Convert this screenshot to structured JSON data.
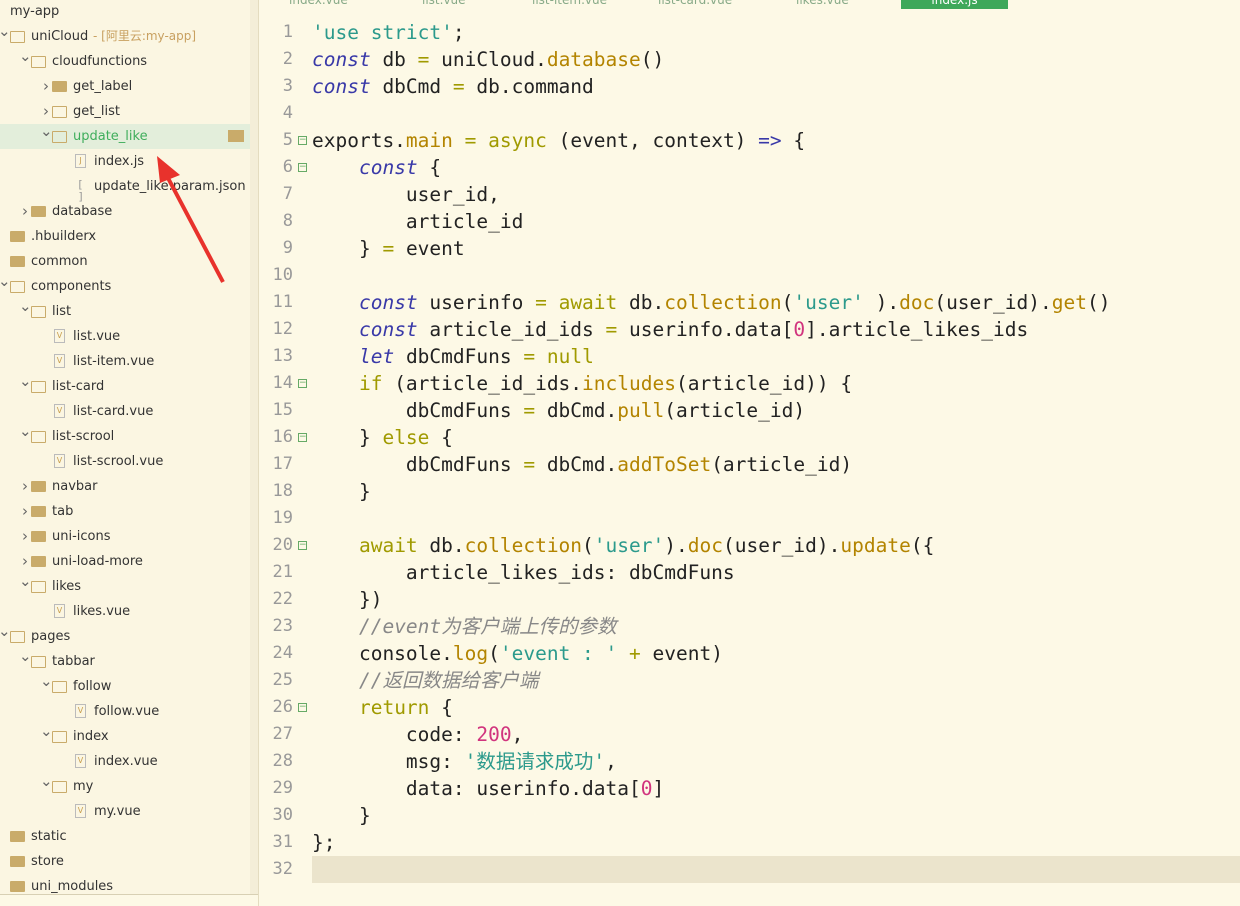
{
  "tabs": [
    {
      "label": "index.vue"
    },
    {
      "label": "list.vue"
    },
    {
      "label": "list-item.vue"
    },
    {
      "label": "list-card.vue"
    },
    {
      "label": "likes.vue"
    },
    {
      "label": "index.js",
      "active": true
    }
  ],
  "tree": [
    {
      "label": "my-app",
      "level": -1,
      "type": "root"
    },
    {
      "label": "uniCloud",
      "extra": " - [阿里云:my-app]",
      "level": 0,
      "type": "folder",
      "open": true
    },
    {
      "label": "cloudfunctions",
      "level": 1,
      "type": "folder",
      "open": true
    },
    {
      "label": "get_label",
      "level": 2,
      "type": "folder",
      "open": false
    },
    {
      "label": "get_list",
      "level": 2,
      "type": "folder",
      "open": false,
      "openIcon": true
    },
    {
      "label": "update_like",
      "level": 2,
      "type": "folder",
      "open": true,
      "selected": true
    },
    {
      "label": "index.js",
      "level": 3,
      "type": "file",
      "icon": "js"
    },
    {
      "label": "update_like.param.json",
      "level": 3,
      "type": "file",
      "icon": "json"
    },
    {
      "label": "database",
      "level": 1,
      "type": "folder",
      "open": false
    },
    {
      "label": ".hbuilderx",
      "level": 0,
      "type": "folder",
      "noarrow": true
    },
    {
      "label": "common",
      "level": 0,
      "type": "folder",
      "noarrow": true
    },
    {
      "label": "components",
      "level": 0,
      "type": "folder",
      "open": true
    },
    {
      "label": "list",
      "level": 1,
      "type": "folder",
      "open": true
    },
    {
      "label": "list.vue",
      "level": 2,
      "type": "file",
      "icon": "vue"
    },
    {
      "label": "list-item.vue",
      "level": 2,
      "type": "file",
      "icon": "vue"
    },
    {
      "label": "list-card",
      "level": 1,
      "type": "folder",
      "open": true
    },
    {
      "label": "list-card.vue",
      "level": 2,
      "type": "file",
      "icon": "vue"
    },
    {
      "label": "list-scrool",
      "level": 1,
      "type": "folder",
      "open": true
    },
    {
      "label": "list-scrool.vue",
      "level": 2,
      "type": "file",
      "icon": "vue"
    },
    {
      "label": "navbar",
      "level": 1,
      "type": "folder",
      "open": false
    },
    {
      "label": "tab",
      "level": 1,
      "type": "folder",
      "open": false
    },
    {
      "label": "uni-icons",
      "level": 1,
      "type": "folder",
      "open": false
    },
    {
      "label": "uni-load-more",
      "level": 1,
      "type": "folder",
      "open": false
    },
    {
      "label": "likes",
      "level": 1,
      "type": "folder",
      "open": true
    },
    {
      "label": "likes.vue",
      "level": 2,
      "type": "file",
      "icon": "vue"
    },
    {
      "label": "pages",
      "level": 0,
      "type": "folder",
      "open": true
    },
    {
      "label": "tabbar",
      "level": 1,
      "type": "folder",
      "open": true
    },
    {
      "label": "follow",
      "level": 2,
      "type": "folder",
      "open": true
    },
    {
      "label": "follow.vue",
      "level": 3,
      "type": "file",
      "icon": "vue"
    },
    {
      "label": "index",
      "level": 2,
      "type": "folder",
      "open": true
    },
    {
      "label": "index.vue",
      "level": 3,
      "type": "file",
      "icon": "vue"
    },
    {
      "label": "my",
      "level": 2,
      "type": "folder",
      "open": true
    },
    {
      "label": "my.vue",
      "level": 3,
      "type": "file",
      "icon": "vue"
    },
    {
      "label": "static",
      "level": 0,
      "type": "folder",
      "noarrow": true
    },
    {
      "label": "store",
      "level": 0,
      "type": "folder",
      "noarrow": true
    },
    {
      "label": "uni_modules",
      "level": 0,
      "type": "folder",
      "noarrow": true
    }
  ],
  "code": [
    {
      "t": [
        [
          "str",
          "'use strict'"
        ],
        [
          "",
          "; "
        ]
      ]
    },
    {
      "t": [
        [
          "kw",
          "const"
        ],
        [
          "",
          " db "
        ],
        [
          "op",
          "="
        ],
        [
          "",
          " uniCloud."
        ],
        [
          "fn",
          "database"
        ],
        [
          "",
          "()"
        ]
      ]
    },
    {
      "t": [
        [
          "kw",
          "const"
        ],
        [
          "",
          " dbCmd "
        ],
        [
          "op",
          "="
        ],
        [
          "",
          " db.command"
        ]
      ]
    },
    {
      "t": []
    },
    {
      "fold": true,
      "indent": 0,
      "t": [
        [
          "",
          "exports."
        ],
        [
          "fn",
          "main"
        ],
        [
          "",
          " "
        ],
        [
          "op",
          "="
        ],
        [
          "",
          " "
        ],
        [
          "kw2",
          "async"
        ],
        [
          "",
          " (event, context) "
        ],
        [
          "kw",
          "=>"
        ],
        [
          "",
          " {"
        ]
      ]
    },
    {
      "fold": true,
      "t": [
        [
          "",
          "    "
        ],
        [
          "kw",
          "const"
        ],
        [
          "",
          " {"
        ]
      ]
    },
    {
      "t": [
        [
          "",
          "        user_id,"
        ]
      ]
    },
    {
      "t": [
        [
          "",
          "        article_id"
        ]
      ]
    },
    {
      "t": [
        [
          "",
          "    } "
        ],
        [
          "op",
          "="
        ],
        [
          "",
          " event"
        ]
      ]
    },
    {
      "t": []
    },
    {
      "t": [
        [
          "",
          "    "
        ],
        [
          "kw",
          "const"
        ],
        [
          "",
          " userinfo "
        ],
        [
          "op",
          "="
        ],
        [
          "",
          " "
        ],
        [
          "kw2",
          "await"
        ],
        [
          "",
          " db."
        ],
        [
          "fn",
          "collection"
        ],
        [
          "",
          "("
        ],
        [
          "str",
          "'user'"
        ],
        [
          "",
          " )."
        ],
        [
          "fn",
          "doc"
        ],
        [
          "",
          "(user_id)."
        ],
        [
          "fn",
          "get"
        ],
        [
          "",
          "()"
        ]
      ]
    },
    {
      "t": [
        [
          "",
          "    "
        ],
        [
          "kw",
          "const"
        ],
        [
          "",
          " article_id_ids "
        ],
        [
          "op",
          "="
        ],
        [
          "",
          " userinfo.data["
        ],
        [
          "num",
          "0"
        ],
        [
          "",
          "].article_likes_ids"
        ]
      ]
    },
    {
      "t": [
        [
          "",
          "    "
        ],
        [
          "kw",
          "let"
        ],
        [
          "",
          " dbCmdFuns "
        ],
        [
          "op",
          "="
        ],
        [
          "",
          " "
        ],
        [
          "kw2",
          "null"
        ]
      ]
    },
    {
      "fold": true,
      "t": [
        [
          "",
          "    "
        ],
        [
          "kw2",
          "if"
        ],
        [
          "",
          " (article_id_ids."
        ],
        [
          "fn",
          "includes"
        ],
        [
          "",
          "(article_id)) {"
        ]
      ]
    },
    {
      "t": [
        [
          "",
          "        dbCmdFuns "
        ],
        [
          "op",
          "="
        ],
        [
          "",
          " dbCmd."
        ],
        [
          "fn",
          "pull"
        ],
        [
          "",
          "(article_id)"
        ]
      ]
    },
    {
      "fold": true,
      "t": [
        [
          "",
          "    } "
        ],
        [
          "kw2",
          "else"
        ],
        [
          "",
          " {"
        ]
      ]
    },
    {
      "t": [
        [
          "",
          "        dbCmdFuns "
        ],
        [
          "op",
          "="
        ],
        [
          "",
          " dbCmd."
        ],
        [
          "fn",
          "addToSet"
        ],
        [
          "",
          "(article_id)"
        ]
      ]
    },
    {
      "t": [
        [
          "",
          "    }"
        ]
      ]
    },
    {
      "t": []
    },
    {
      "fold": true,
      "t": [
        [
          "",
          "    "
        ],
        [
          "kw2",
          "await"
        ],
        [
          "",
          " db."
        ],
        [
          "fn",
          "collection"
        ],
        [
          "",
          "("
        ],
        [
          "str",
          "'user'"
        ],
        [
          "",
          ")."
        ],
        [
          "fn",
          "doc"
        ],
        [
          "",
          "(user_id)."
        ],
        [
          "fn",
          "update"
        ],
        [
          "",
          "({"
        ]
      ]
    },
    {
      "t": [
        [
          "",
          "        article_likes_ids: dbCmdFuns"
        ]
      ]
    },
    {
      "t": [
        [
          "",
          "    })"
        ]
      ]
    },
    {
      "t": [
        [
          "",
          "    "
        ],
        [
          "cmt",
          "//event为客户端上传的参数"
        ]
      ]
    },
    {
      "t": [
        [
          "",
          "    console."
        ],
        [
          "fn",
          "log"
        ],
        [
          "",
          "("
        ],
        [
          "str",
          "'event : '"
        ],
        [
          "",
          " "
        ],
        [
          "op",
          "+"
        ],
        [
          "",
          " event)"
        ]
      ]
    },
    {
      "t": [
        [
          "",
          "    "
        ],
        [
          "cmt",
          "//返回数据给客户端"
        ]
      ]
    },
    {
      "fold": true,
      "t": [
        [
          "",
          "    "
        ],
        [
          "kw2",
          "return"
        ],
        [
          "",
          " {"
        ]
      ]
    },
    {
      "t": [
        [
          "",
          "        code: "
        ],
        [
          "num",
          "200"
        ],
        [
          "",
          ","
        ]
      ]
    },
    {
      "t": [
        [
          "",
          "        msg: "
        ],
        [
          "str",
          "'数据请求成功'"
        ],
        [
          "",
          ","
        ]
      ]
    },
    {
      "t": [
        [
          "",
          "        data: userinfo.data["
        ],
        [
          "num",
          "0"
        ],
        [
          "",
          "]"
        ]
      ]
    },
    {
      "t": [
        [
          "",
          "    }"
        ]
      ]
    },
    {
      "t": [
        [
          "",
          "};"
        ]
      ]
    },
    {
      "t": [],
      "current": true
    }
  ],
  "colors": {
    "accent": "#3ea85a",
    "annotation_arrow": "#e8322c"
  }
}
